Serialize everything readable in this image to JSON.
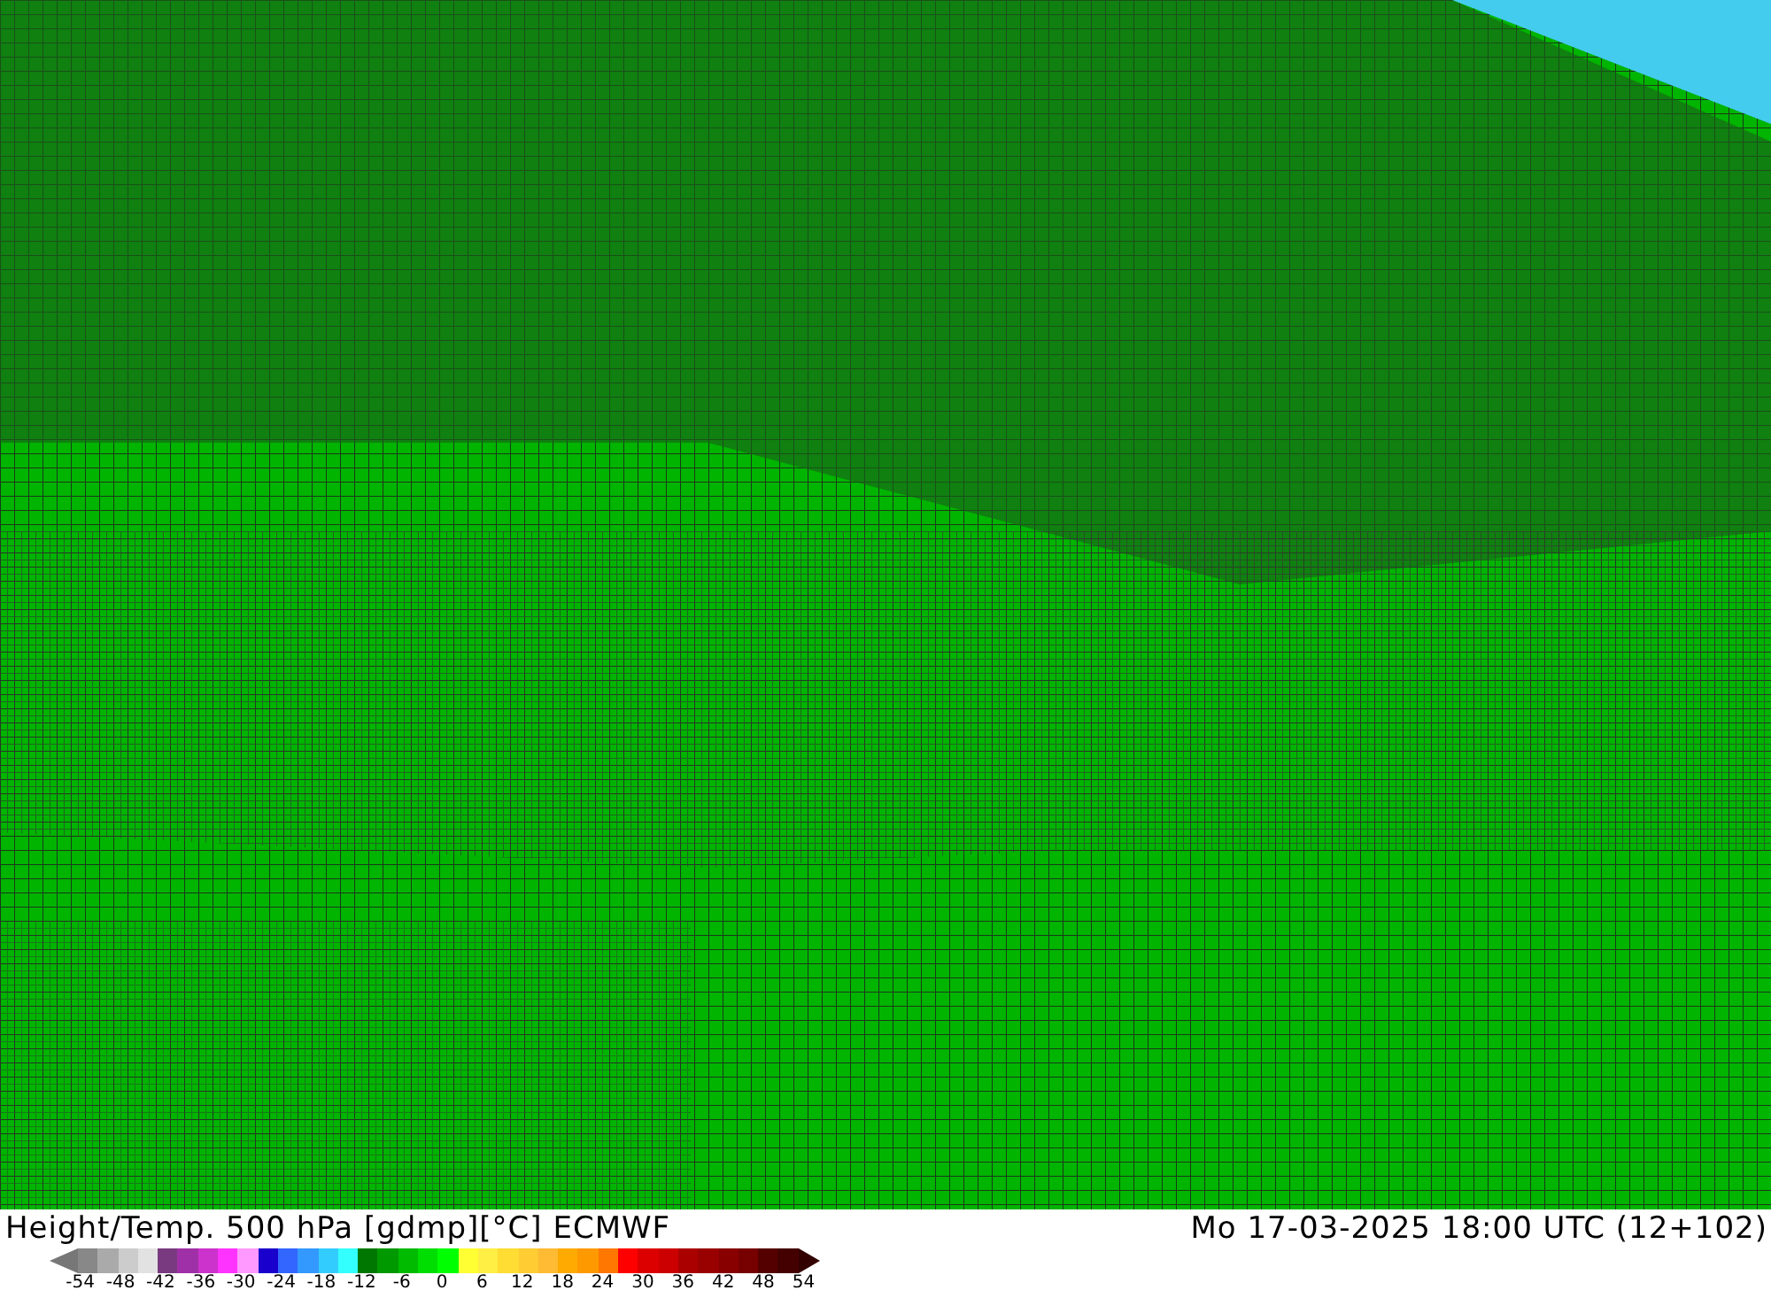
{
  "title": "Height/Temp. 500 hPa [gdmp][°C] ECMWF",
  "timestamp": "Mo 17-03-2025 18:00 UTC (12+102)",
  "colorbar": {
    "swatches": [
      {
        "color": "#888888"
      },
      {
        "color": "#aaaaaa"
      },
      {
        "color": "#cccccc"
      },
      {
        "color": "#e2e2e2"
      },
      {
        "color": "#7a3a80"
      },
      {
        "color": "#a030a8"
      },
      {
        "color": "#cc33cc"
      },
      {
        "color": "#ff33ff"
      },
      {
        "color": "#ff99ff"
      },
      {
        "color": "#1a00cc"
      },
      {
        "color": "#3366ff"
      },
      {
        "color": "#3399ff"
      },
      {
        "color": "#33ccff"
      },
      {
        "color": "#33ffff"
      },
      {
        "color": "#007700"
      },
      {
        "color": "#009900"
      },
      {
        "color": "#00bb00"
      },
      {
        "color": "#00dd00"
      },
      {
        "color": "#00ff00"
      },
      {
        "color": "#ffff33"
      },
      {
        "color": "#ffee44"
      },
      {
        "color": "#ffdd33"
      },
      {
        "color": "#ffcc33"
      },
      {
        "color": "#ffbb33"
      },
      {
        "color": "#ffaa00"
      },
      {
        "color": "#ff9900"
      },
      {
        "color": "#ff7700"
      },
      {
        "color": "#ff0000"
      },
      {
        "color": "#dd0000"
      },
      {
        "color": "#cc0000"
      },
      {
        "color": "#aa0000"
      },
      {
        "color": "#990000"
      },
      {
        "color": "#880000"
      },
      {
        "color": "#770000"
      },
      {
        "color": "#550000"
      },
      {
        "color": "#440000"
      }
    ],
    "ticks": [
      "-54",
      "-48",
      "-42",
      "-36",
      "-30",
      "-24",
      "-18",
      "-12",
      "-6",
      "0",
      "6",
      "12",
      "18",
      "24",
      "30",
      "36",
      "42",
      "48",
      "54"
    ]
  }
}
